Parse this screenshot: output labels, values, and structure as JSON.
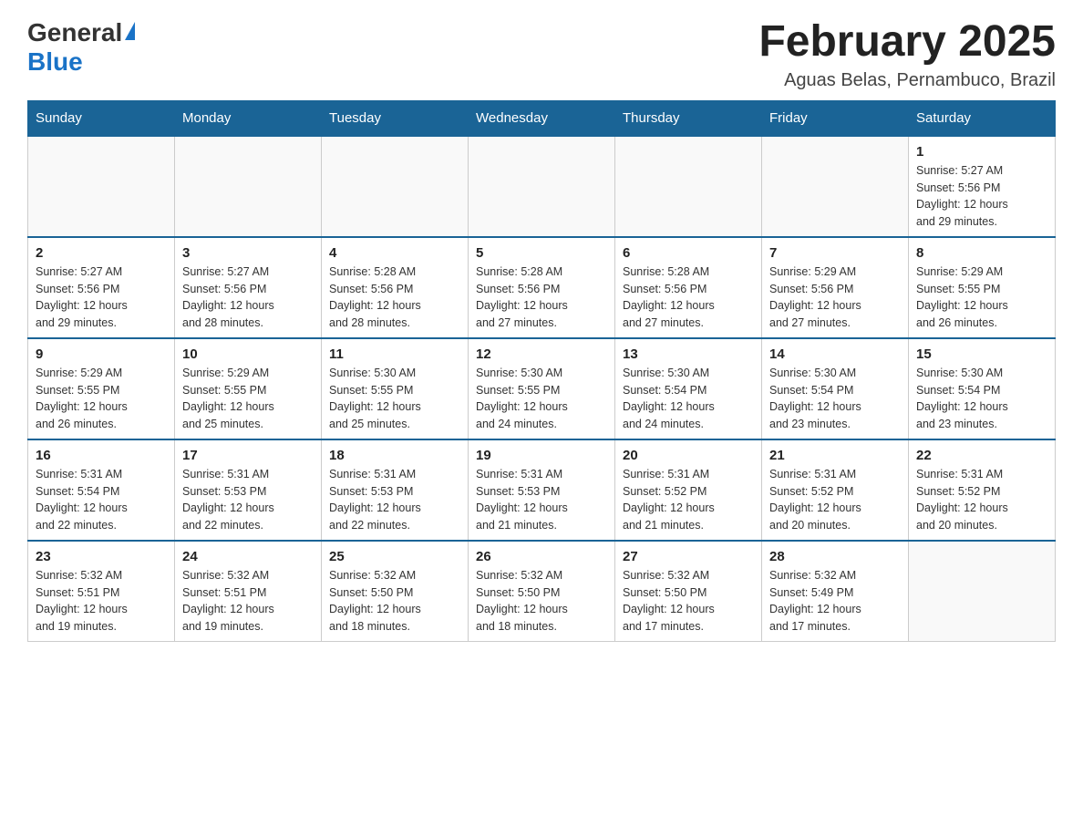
{
  "header": {
    "logo_general": "General",
    "logo_blue": "Blue",
    "month_title": "February 2025",
    "location": "Aguas Belas, Pernambuco, Brazil"
  },
  "weekdays": [
    "Sunday",
    "Monday",
    "Tuesday",
    "Wednesday",
    "Thursday",
    "Friday",
    "Saturday"
  ],
  "weeks": [
    [
      {
        "day": "",
        "info": ""
      },
      {
        "day": "",
        "info": ""
      },
      {
        "day": "",
        "info": ""
      },
      {
        "day": "",
        "info": ""
      },
      {
        "day": "",
        "info": ""
      },
      {
        "day": "",
        "info": ""
      },
      {
        "day": "1",
        "info": "Sunrise: 5:27 AM\nSunset: 5:56 PM\nDaylight: 12 hours\nand 29 minutes."
      }
    ],
    [
      {
        "day": "2",
        "info": "Sunrise: 5:27 AM\nSunset: 5:56 PM\nDaylight: 12 hours\nand 29 minutes."
      },
      {
        "day": "3",
        "info": "Sunrise: 5:27 AM\nSunset: 5:56 PM\nDaylight: 12 hours\nand 28 minutes."
      },
      {
        "day": "4",
        "info": "Sunrise: 5:28 AM\nSunset: 5:56 PM\nDaylight: 12 hours\nand 28 minutes."
      },
      {
        "day": "5",
        "info": "Sunrise: 5:28 AM\nSunset: 5:56 PM\nDaylight: 12 hours\nand 27 minutes."
      },
      {
        "day": "6",
        "info": "Sunrise: 5:28 AM\nSunset: 5:56 PM\nDaylight: 12 hours\nand 27 minutes."
      },
      {
        "day": "7",
        "info": "Sunrise: 5:29 AM\nSunset: 5:56 PM\nDaylight: 12 hours\nand 27 minutes."
      },
      {
        "day": "8",
        "info": "Sunrise: 5:29 AM\nSunset: 5:55 PM\nDaylight: 12 hours\nand 26 minutes."
      }
    ],
    [
      {
        "day": "9",
        "info": "Sunrise: 5:29 AM\nSunset: 5:55 PM\nDaylight: 12 hours\nand 26 minutes."
      },
      {
        "day": "10",
        "info": "Sunrise: 5:29 AM\nSunset: 5:55 PM\nDaylight: 12 hours\nand 25 minutes."
      },
      {
        "day": "11",
        "info": "Sunrise: 5:30 AM\nSunset: 5:55 PM\nDaylight: 12 hours\nand 25 minutes."
      },
      {
        "day": "12",
        "info": "Sunrise: 5:30 AM\nSunset: 5:55 PM\nDaylight: 12 hours\nand 24 minutes."
      },
      {
        "day": "13",
        "info": "Sunrise: 5:30 AM\nSunset: 5:54 PM\nDaylight: 12 hours\nand 24 minutes."
      },
      {
        "day": "14",
        "info": "Sunrise: 5:30 AM\nSunset: 5:54 PM\nDaylight: 12 hours\nand 23 minutes."
      },
      {
        "day": "15",
        "info": "Sunrise: 5:30 AM\nSunset: 5:54 PM\nDaylight: 12 hours\nand 23 minutes."
      }
    ],
    [
      {
        "day": "16",
        "info": "Sunrise: 5:31 AM\nSunset: 5:54 PM\nDaylight: 12 hours\nand 22 minutes."
      },
      {
        "day": "17",
        "info": "Sunrise: 5:31 AM\nSunset: 5:53 PM\nDaylight: 12 hours\nand 22 minutes."
      },
      {
        "day": "18",
        "info": "Sunrise: 5:31 AM\nSunset: 5:53 PM\nDaylight: 12 hours\nand 22 minutes."
      },
      {
        "day": "19",
        "info": "Sunrise: 5:31 AM\nSunset: 5:53 PM\nDaylight: 12 hours\nand 21 minutes."
      },
      {
        "day": "20",
        "info": "Sunrise: 5:31 AM\nSunset: 5:52 PM\nDaylight: 12 hours\nand 21 minutes."
      },
      {
        "day": "21",
        "info": "Sunrise: 5:31 AM\nSunset: 5:52 PM\nDaylight: 12 hours\nand 20 minutes."
      },
      {
        "day": "22",
        "info": "Sunrise: 5:31 AM\nSunset: 5:52 PM\nDaylight: 12 hours\nand 20 minutes."
      }
    ],
    [
      {
        "day": "23",
        "info": "Sunrise: 5:32 AM\nSunset: 5:51 PM\nDaylight: 12 hours\nand 19 minutes."
      },
      {
        "day": "24",
        "info": "Sunrise: 5:32 AM\nSunset: 5:51 PM\nDaylight: 12 hours\nand 19 minutes."
      },
      {
        "day": "25",
        "info": "Sunrise: 5:32 AM\nSunset: 5:50 PM\nDaylight: 12 hours\nand 18 minutes."
      },
      {
        "day": "26",
        "info": "Sunrise: 5:32 AM\nSunset: 5:50 PM\nDaylight: 12 hours\nand 18 minutes."
      },
      {
        "day": "27",
        "info": "Sunrise: 5:32 AM\nSunset: 5:50 PM\nDaylight: 12 hours\nand 17 minutes."
      },
      {
        "day": "28",
        "info": "Sunrise: 5:32 AM\nSunset: 5:49 PM\nDaylight: 12 hours\nand 17 minutes."
      },
      {
        "day": "",
        "info": ""
      }
    ]
  ]
}
